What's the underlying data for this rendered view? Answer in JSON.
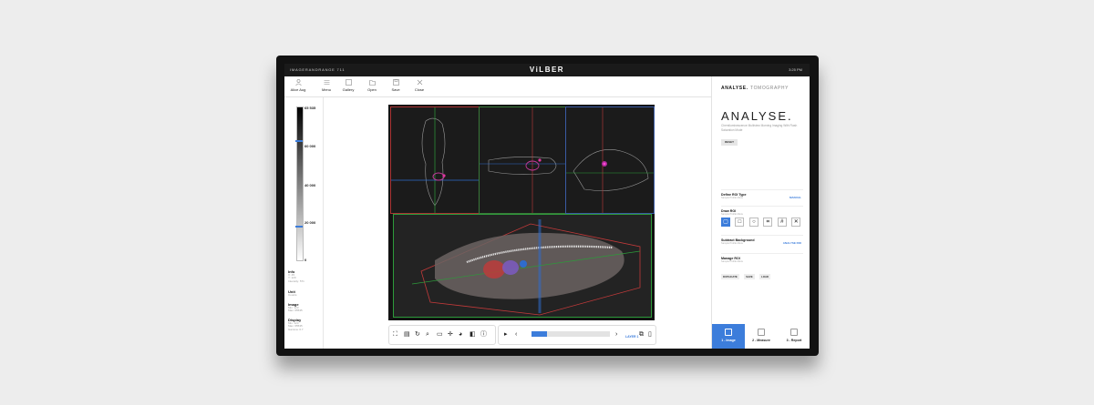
{
  "topbar": {
    "left_label": "IMAGERANDRANGE 711",
    "brand": "ViLBER",
    "time": "3:25 PM"
  },
  "toolbar": [
    {
      "label": "Alice Aug",
      "icon": "person-icon"
    },
    {
      "label": "Menu",
      "icon": "menu-icon"
    },
    {
      "label": "Gallery",
      "icon": "image-icon"
    },
    {
      "label": "Open",
      "icon": "folder-icon"
    },
    {
      "label": "Save",
      "icon": "save-icon"
    },
    {
      "label": "Close",
      "icon": "close-icon"
    }
  ],
  "scale": {
    "labels": [
      "65 535",
      "60 000",
      "40 000",
      "20 000",
      "0"
    ]
  },
  "info": {
    "info": {
      "title": "Info",
      "lines": [
        "X: 45",
        "Y: 120",
        "Intensity: 571"
      ]
    },
    "unit": {
      "title": "Unit",
      "lines": [
        "Counts"
      ]
    },
    "image": {
      "title": "Image",
      "lines": [
        "Min: 123",
        "Max: 65535"
      ]
    },
    "display": {
      "title": "Display",
      "lines": [
        "Min: 123",
        "Max: 65535",
        "Gamma: 0.7"
      ]
    }
  },
  "right_panel": {
    "tabs": [
      "ANALYSE.",
      "TOMOGRAPHY"
    ],
    "title": "ANALYSE.",
    "description": "Chemiluminescence Multiview Morning Imaging With Flash Saturation Mode",
    "reset": "RESET",
    "define_roi": {
      "title": "Define ROI Type",
      "subtitle": "Sample Profile Menu",
      "action": "MANUAL"
    },
    "draw_roi": {
      "title": "Draw ROI",
      "subtitle": "Sample Profile Menu"
    },
    "subtract": {
      "title": "Subtract Background",
      "subtitle": "Sample Profile Menu",
      "action": "ANALYSE ROI"
    },
    "manage_roi": {
      "title": "Manage ROI",
      "subtitle": "Sample Profile Menu",
      "buttons": [
        "DUPLICATE",
        "SAVE",
        "LOAD"
      ]
    },
    "steps": [
      {
        "label": "1 - Image",
        "active": true
      },
      {
        "label": "2 - Measure",
        "active": false
      },
      {
        "label": "3 - Report",
        "active": false
      }
    ]
  },
  "bottom_toolbar": {
    "layer": "LAYER 1",
    "progress": 0.2
  },
  "colors": {
    "accent": "#3c7ddb",
    "topbar": "#1a1a1a"
  }
}
